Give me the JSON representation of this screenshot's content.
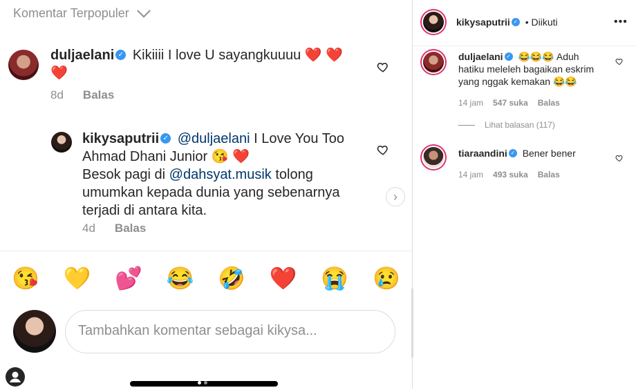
{
  "left": {
    "sort_label": "Komentar Terpopuler",
    "comment1": {
      "username": "duljaelani",
      "text": "Kikiiii I love U sayangkuuuu",
      "hearts": "❤️ ❤️",
      "hearts2": "❤️",
      "time": "8d",
      "reply": "Balas"
    },
    "reply1": {
      "username": "kikysaputrii",
      "mention": "@duljaelani",
      "text_a": "I Love You Too",
      "text_b": "Ahmad Dhani Junior",
      "emoji_b": "😘 ❤️",
      "text_c": "Besok pagi di",
      "mention2": "@dahsyat.musik",
      "text_c2": "tolong",
      "text_d": "umumkan kepada dunia yang sebenarnya",
      "text_e": "terjadi di antara kita.",
      "time": "4d",
      "reply": "Balas"
    },
    "emojis": [
      "😘",
      "💛",
      "💕",
      "😂",
      "🤣",
      "❤️",
      "😭",
      "😢"
    ],
    "input_placeholder": "Tambahkan komentar sebagai kikysa..."
  },
  "right": {
    "header": {
      "username": "kikysaputrii",
      "follow_status": "• Diikuti",
      "more": "•••"
    },
    "comments": [
      {
        "username": "duljaelani",
        "line1": "😂😂😂 Aduh",
        "line2": "hatiku meleleh bagaikan eskrim",
        "line3": "yang nggak kemakan 😂😂",
        "time": "14 jam",
        "likes": "547 suka",
        "reply": "Balas",
        "view_replies": "Lihat balasan (117)"
      },
      {
        "username": "tiaraandini",
        "line1": "Bener bener",
        "time": "14 jam",
        "likes": "493 suka",
        "reply": "Balas"
      }
    ]
  },
  "colors": {
    "verified": "#3897f0",
    "mention": "#00376b",
    "muted": "#8e8e8e",
    "heart": "#e0245e"
  }
}
